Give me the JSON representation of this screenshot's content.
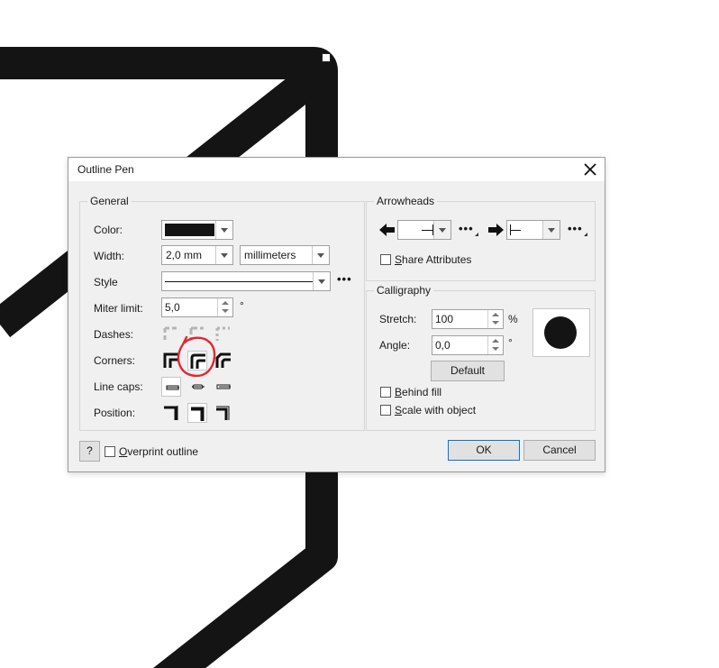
{
  "dialog": {
    "title": "Outline Pen",
    "close_symbol": "✕"
  },
  "general": {
    "label": "General",
    "color_label": "Color:",
    "color_value": "#141414",
    "width_label": "Width:",
    "width_value": "2,0 mm",
    "width_unit": "millimeters",
    "style_label": "Style",
    "miter_label": "Miter limit:",
    "miter_value": "5,0",
    "miter_unit": "°",
    "dashes_label": "Dashes:",
    "corners_label": "Corners:",
    "corners_selected": 1,
    "linecaps_label": "Line caps:",
    "linecaps_selected": 0,
    "position_label": "Position:",
    "position_selected": 1
  },
  "arrowheads": {
    "label": "Arrowheads",
    "share_label": "Share Attributes",
    "share_checked": false
  },
  "calligraphy": {
    "label": "Calligraphy",
    "stretch_label": "Stretch:",
    "stretch_value": "100",
    "stretch_unit": "%",
    "angle_label": "Angle:",
    "angle_value": "0,0",
    "angle_unit": "°",
    "default_label": "Default"
  },
  "options": {
    "behind_fill_label": "Behind fill",
    "behind_fill_checked": false,
    "scale_label": "Scale with object",
    "scale_checked": false
  },
  "footer": {
    "help_label": "?",
    "overprint_label": "Overprint outline",
    "overprint_checked": false,
    "ok_label": "OK",
    "cancel_label": "Cancel"
  },
  "annotation_color": "#e0282e"
}
